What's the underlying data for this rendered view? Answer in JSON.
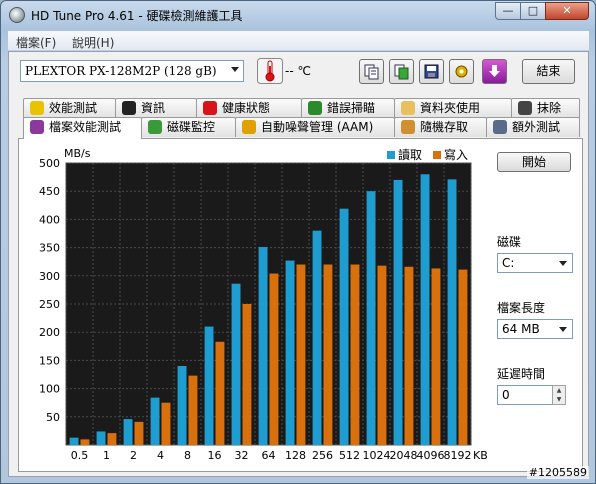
{
  "window": {
    "title": "HD Tune Pro 4.61 - 硬碟檢測維護工具",
    "min_label": "—",
    "max_label": "□",
    "close_label": "✕"
  },
  "menu": {
    "file": "檔案(F)",
    "help": "說明(H)"
  },
  "toolbar": {
    "drive": "PLEXTOR  PX-128M2P      (128 gB)",
    "temperature": "-- ℃",
    "exit_label": "結束",
    "icons": [
      "copy-icon",
      "copy-image-icon",
      "save-icon",
      "settings-icon",
      "download-icon"
    ]
  },
  "tabs_top": [
    {
      "label": "效能測試",
      "icon": "bulb-icon"
    },
    {
      "label": "資訊",
      "icon": "info-icon"
    },
    {
      "label": "健康狀態",
      "icon": "health-icon"
    },
    {
      "label": "錯誤掃瞄",
      "icon": "magnifier-icon"
    },
    {
      "label": "資料夾使用",
      "icon": "folder-icon"
    },
    {
      "label": "抹除",
      "icon": "trash-icon"
    }
  ],
  "tabs_bottom": [
    {
      "label": "檔案效能測試",
      "icon": "file-bench-icon",
      "active": true
    },
    {
      "label": "磁碟監控",
      "icon": "monitor-icon"
    },
    {
      "label": "自動噪聲管理 (AAM)",
      "icon": "speaker-icon"
    },
    {
      "label": "隨機存取",
      "icon": "random-icon"
    },
    {
      "label": "額外測試",
      "icon": "extra-icon"
    }
  ],
  "side": {
    "start_label": "開始",
    "drive_label": "磁碟",
    "drive_value": "C:",
    "filesize_label": "檔案長度",
    "filesize_value": "64 MB",
    "delay_label": "延遲時間",
    "delay_value": "0"
  },
  "colors": {
    "read": "#1f9cd0",
    "write": "#d9700e",
    "plot_bg": "#1a1a1a"
  },
  "chart_data": {
    "type": "bar",
    "ylabel": "MB/s",
    "xlabel": "",
    "ylim": [
      0,
      500
    ],
    "yticks": [
      50,
      100,
      150,
      200,
      250,
      300,
      350,
      400,
      450,
      500
    ],
    "categories": [
      "0.5",
      "1",
      "2",
      "4",
      "8",
      "16",
      "32",
      "64",
      "128",
      "256",
      "512",
      "1024",
      "2048",
      "4096",
      "8192"
    ],
    "unit": "KB",
    "legend_position": "top-right",
    "series": [
      {
        "name": "讀取",
        "values": [
          13,
          24,
          46,
          84,
          140,
          210,
          286,
          351,
          327,
          380,
          419,
          450,
          470,
          480,
          471
        ]
      },
      {
        "name": "寫入",
        "values": [
          10,
          21,
          41,
          75,
          123,
          183,
          250,
          304,
          320,
          320,
          320,
          318,
          316,
          313,
          311
        ]
      }
    ]
  },
  "watermark": "#1205589"
}
